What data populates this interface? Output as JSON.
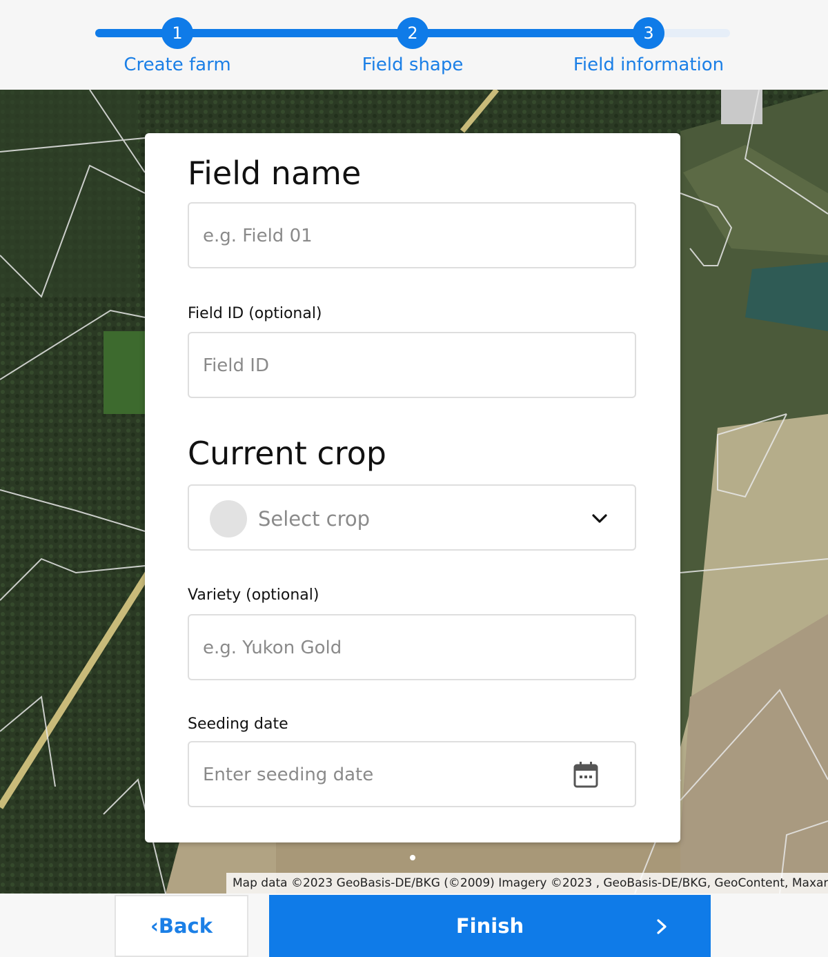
{
  "stepper": {
    "steps": [
      {
        "number": "1",
        "label": "Create farm"
      },
      {
        "number": "2",
        "label": "Field shape"
      },
      {
        "number": "3",
        "label": "Field information"
      }
    ],
    "current_step": 3,
    "accent_color": "#0f7be8"
  },
  "form": {
    "field_name_heading": "Field name",
    "field_name_placeholder": "e.g. Field 01",
    "field_id_label": "Field ID (optional)",
    "field_id_placeholder": "Field ID",
    "current_crop_heading": "Current crop",
    "crop_select_placeholder": "Select crop",
    "variety_label": "Variety (optional)",
    "variety_placeholder": "e.g. Yukon Gold",
    "seeding_date_label": "Seeding date",
    "seeding_date_placeholder": "Enter seeding date"
  },
  "map": {
    "attribution": "Map data ©2023 GeoBasis-DE/BKG (©2009) Imagery ©2023 , GeoBasis-DE/BKG, GeoContent, Maxar"
  },
  "footer": {
    "back_label": "‹Back",
    "finish_label": "Finish"
  },
  "icons": {
    "chevron": "chevron-down-icon",
    "calendar": "calendar-icon",
    "arrow": "chevron-right-icon"
  }
}
